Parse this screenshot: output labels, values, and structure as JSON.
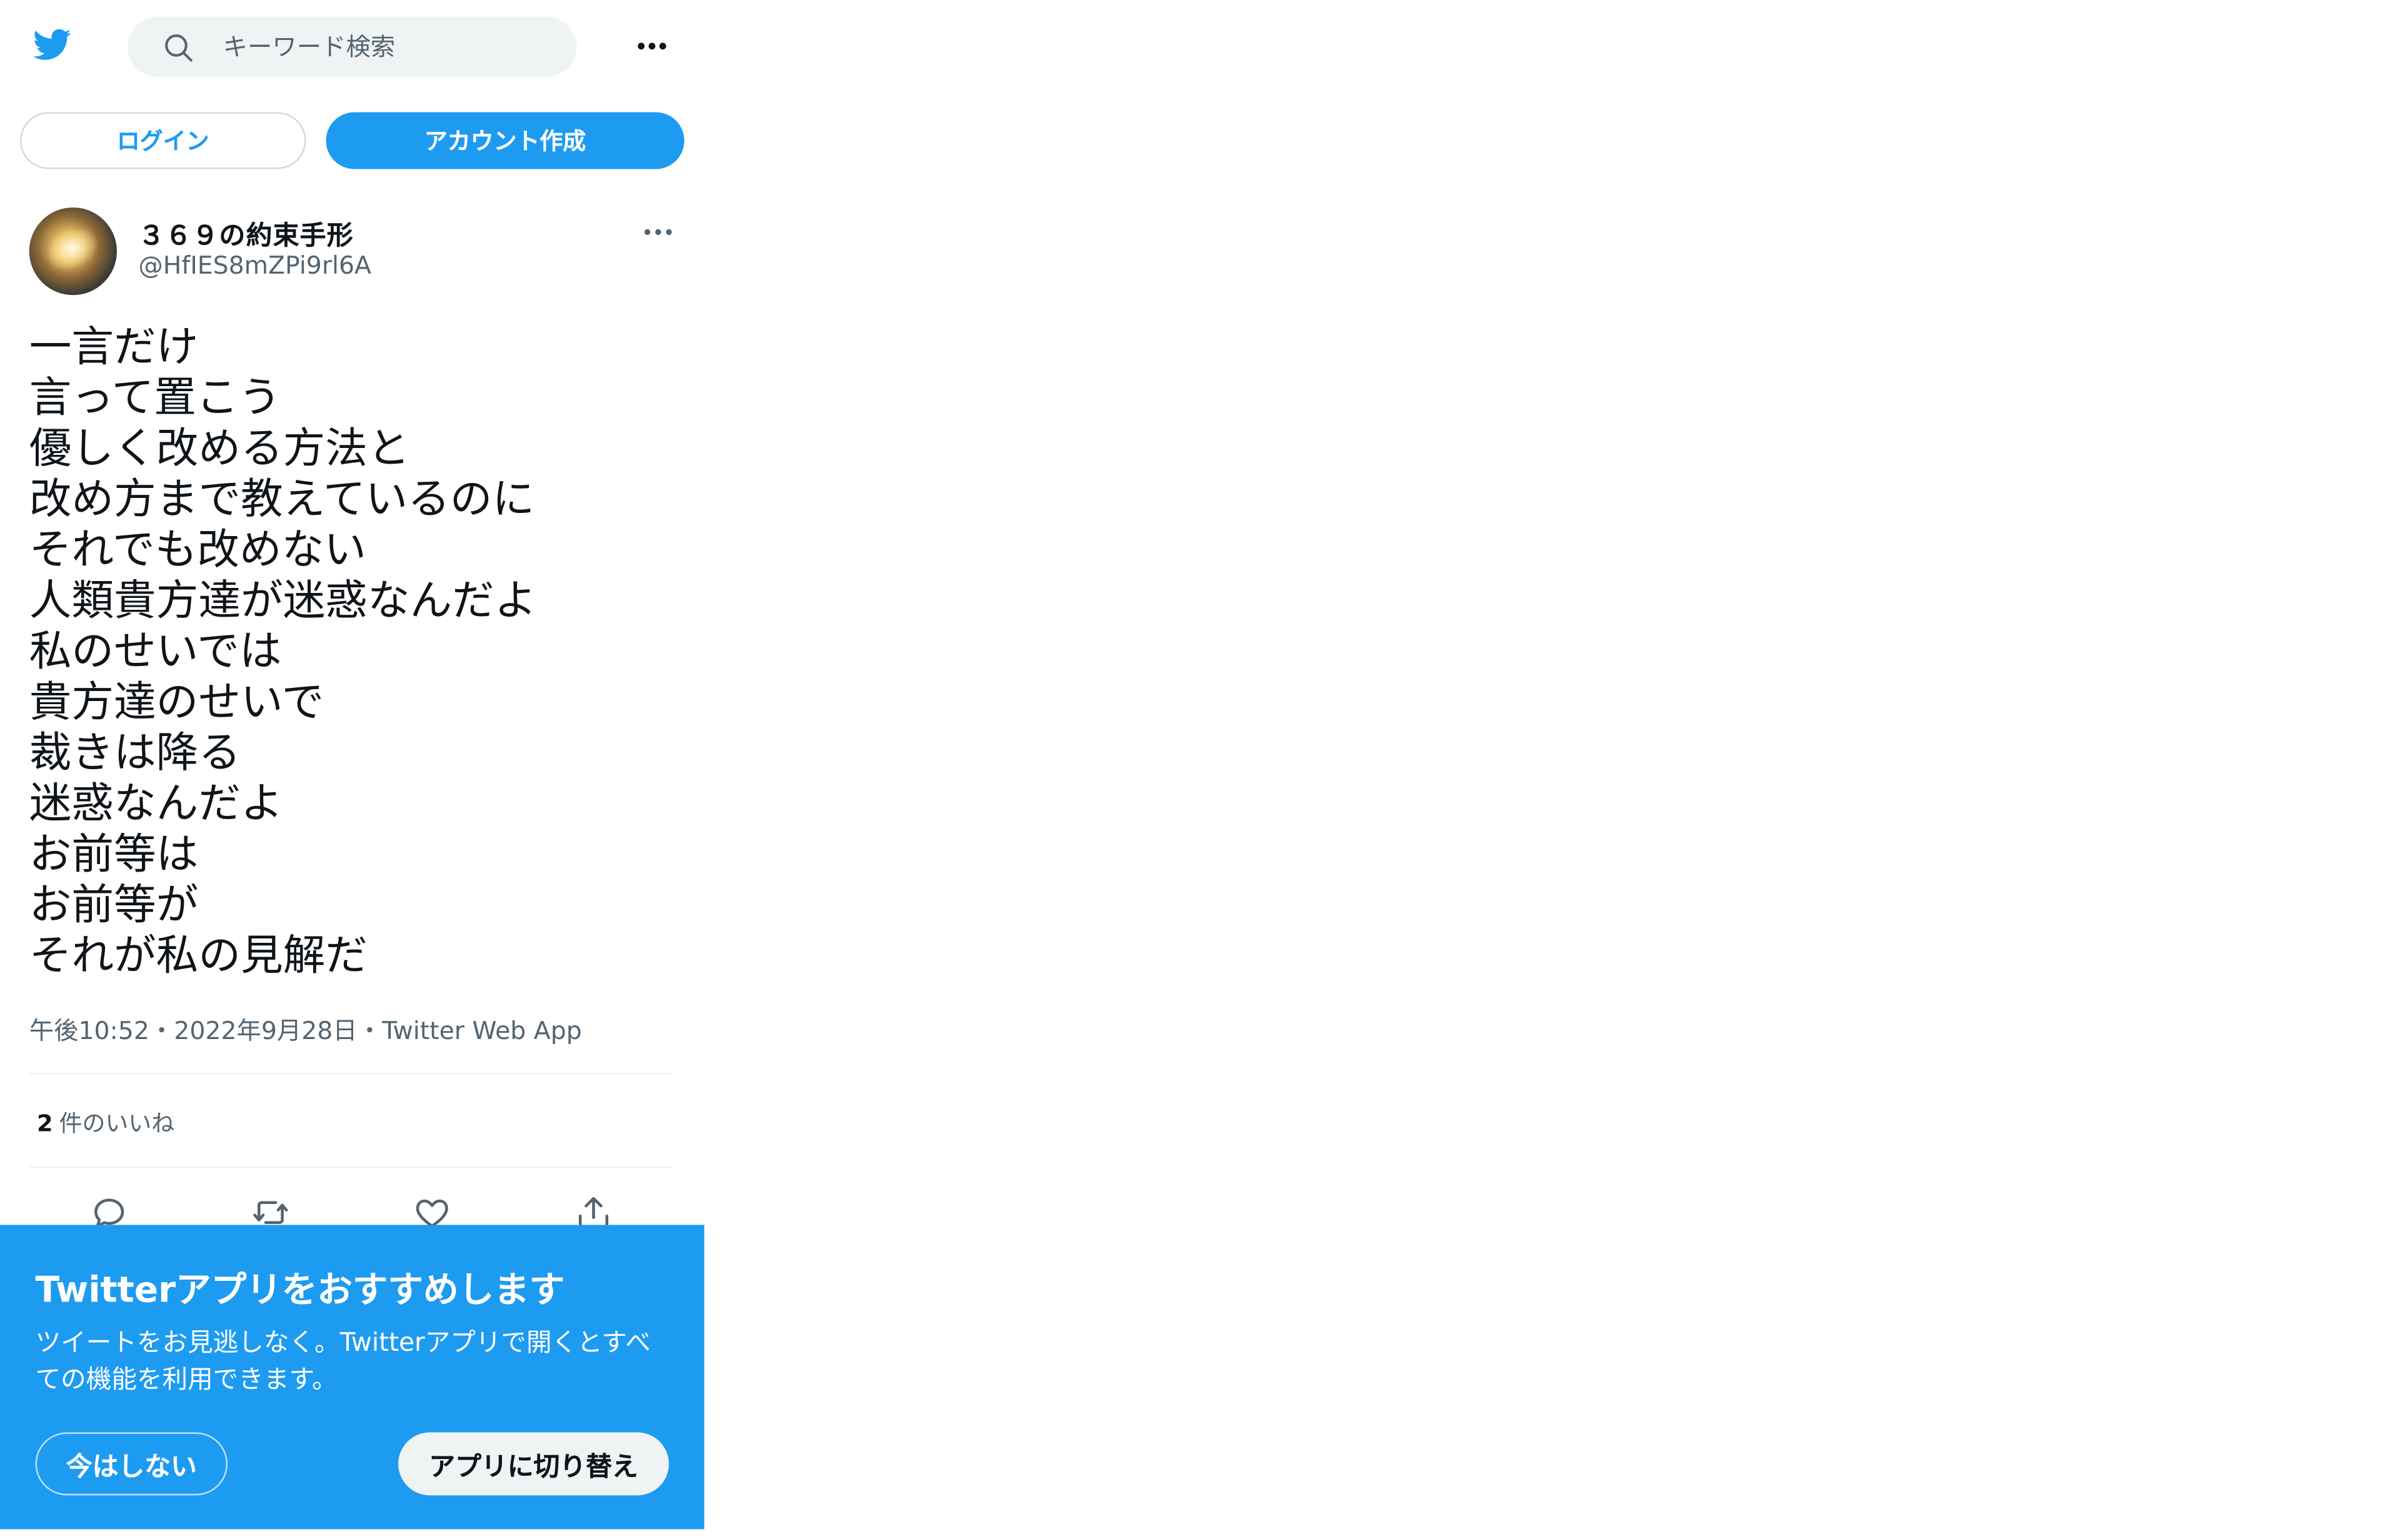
{
  "header": {
    "search_placeholder": "キーワード検索"
  },
  "auth": {
    "login_label": "ログイン",
    "signup_label": "アカウント作成"
  },
  "tweet": {
    "author": {
      "display_name": "３６９の約束手形",
      "handle": "@HfIES8mZPi9rl6A"
    },
    "lines": [
      "一言だけ",
      "言って置こう",
      "優しく改める方法と",
      "改め方まで教えているのに",
      "それでも改めない",
      "人類貴方達が迷惑なんだよ",
      "私のせいでは",
      "貴方達のせいで",
      "裁きは降る",
      "迷惑なんだよ",
      "お前等は",
      "お前等が",
      "それが私の見解だ"
    ],
    "time": "午後10:52",
    "date": "2022年9月28日",
    "source": "Twitter Web App",
    "separator": "・",
    "likes_count": "2",
    "likes_label": "件のいいね"
  },
  "banner": {
    "title": "Twitterアプリをおすすめします",
    "body": "ツイートをお見逃しなく。Twitterアプリで開くとすべての機能を利用できます。",
    "not_now_label": "今はしない",
    "switch_label": "アプリに切り替え"
  },
  "colors": {
    "brand": "#1d9bf0",
    "text": "#0f1419",
    "muted": "#536471",
    "divider": "#eff3f4"
  },
  "icons": [
    "twitter-bird-icon",
    "search-icon",
    "more-icon",
    "reply-icon",
    "retweet-icon",
    "like-icon",
    "share-icon"
  ]
}
